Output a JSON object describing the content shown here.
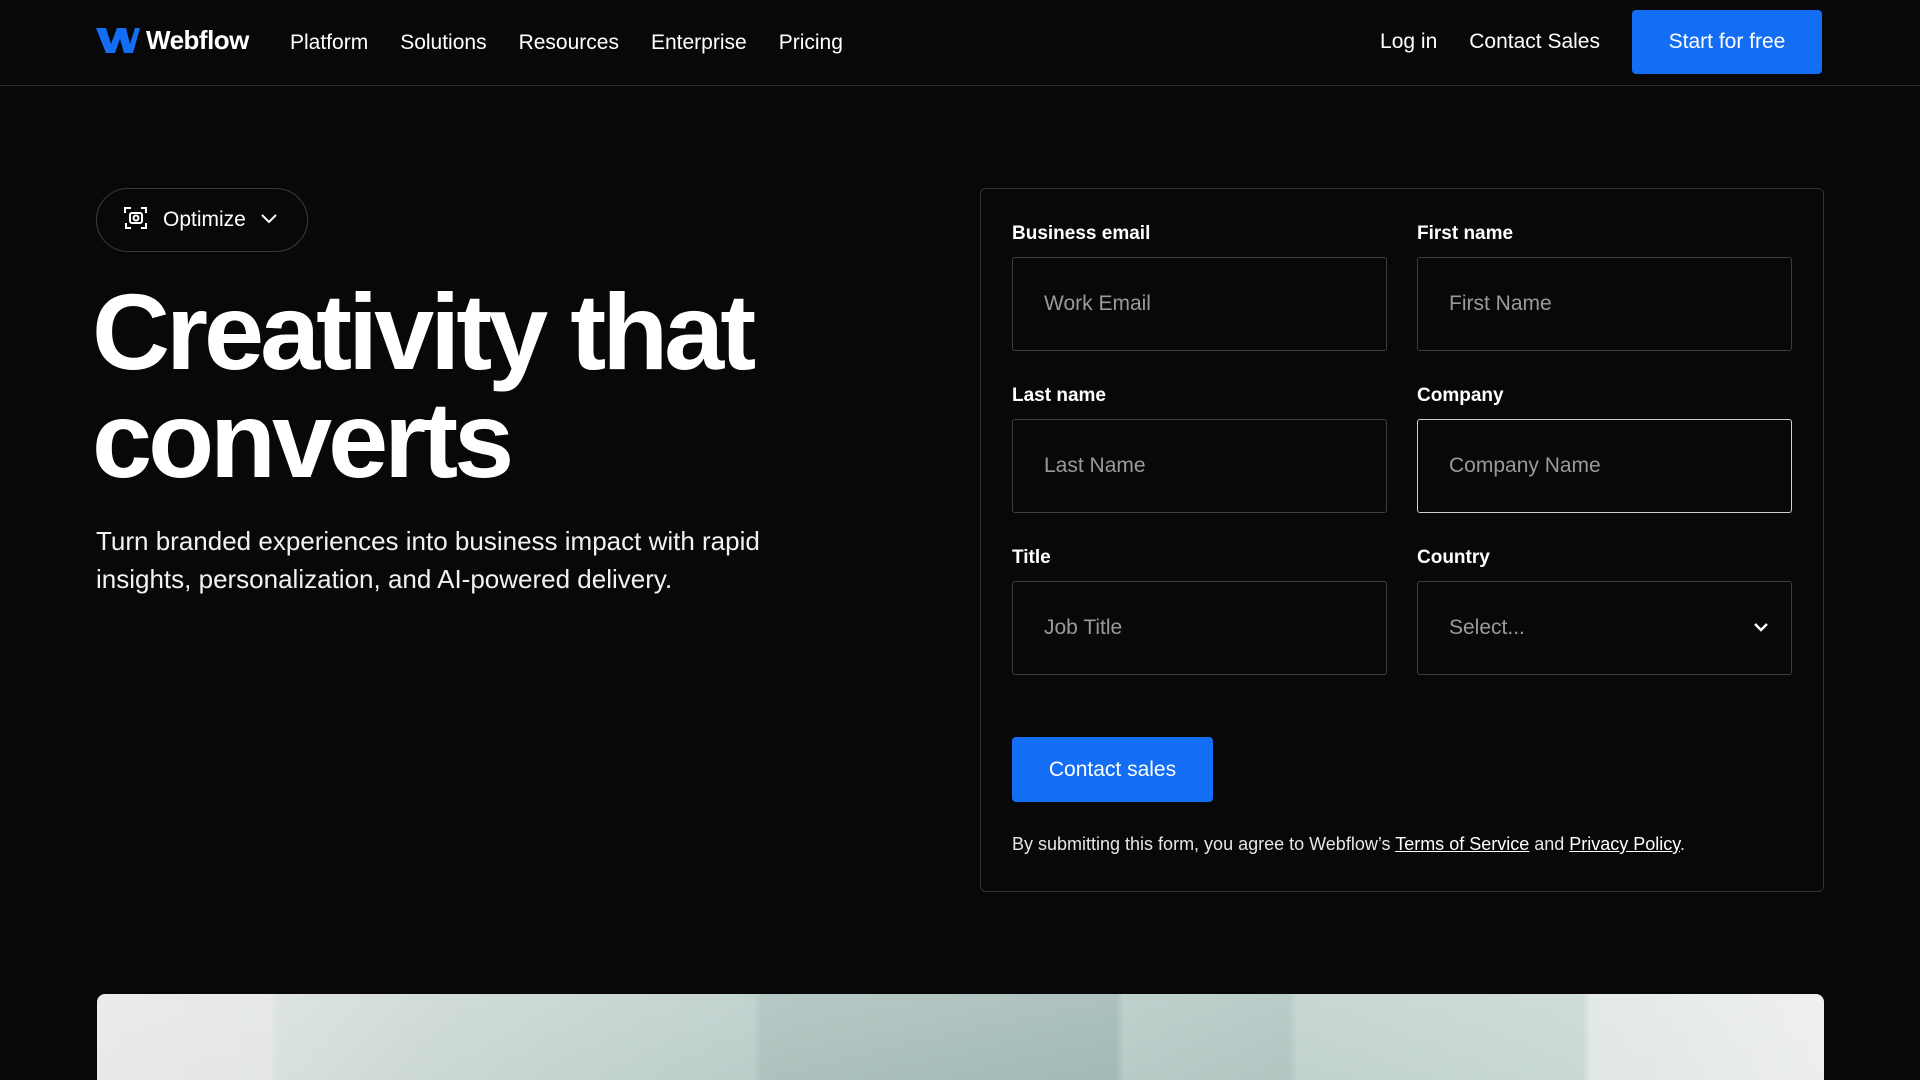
{
  "nav": {
    "brand": "Webflow",
    "links": [
      "Platform",
      "Solutions",
      "Resources",
      "Enterprise",
      "Pricing"
    ],
    "login_label": "Log in",
    "contact_sales_label": "Contact Sales",
    "start_label": "Start for free"
  },
  "hero": {
    "tag_label": "Optimize",
    "title_line1": "Creativity that",
    "title_line2": "converts",
    "subtitle": "Turn branded experiences into business impact with rapid insights, personalization, and AI-powered delivery."
  },
  "form": {
    "email": {
      "label": "Business email",
      "placeholder": "Work Email"
    },
    "first_name": {
      "label": "First name",
      "placeholder": "First Name"
    },
    "last_name": {
      "label": "Last name",
      "placeholder": "Last Name"
    },
    "company": {
      "label": "Company",
      "placeholder": "Company Name"
    },
    "title": {
      "label": "Title",
      "placeholder": "Job Title"
    },
    "country": {
      "label": "Country",
      "value": "Select..."
    },
    "submit_label": "Contact sales",
    "disclaimer_prefix": "By submitting this form, you agree to Webflow’s ",
    "terms_label": "Terms of Service",
    "disclaimer_and": " and ",
    "privacy_label": "Privacy Policy",
    "disclaimer_suffix": "."
  },
  "colors": {
    "background": "#080808",
    "accent": "#146ef5",
    "border": "#3d3d3d"
  },
  "icons": {
    "brand": "webflow-logo-icon",
    "tag": "scan-target-icon",
    "tag_chevron": "chevron-down-icon",
    "select_chevron": "chevron-down-icon"
  }
}
